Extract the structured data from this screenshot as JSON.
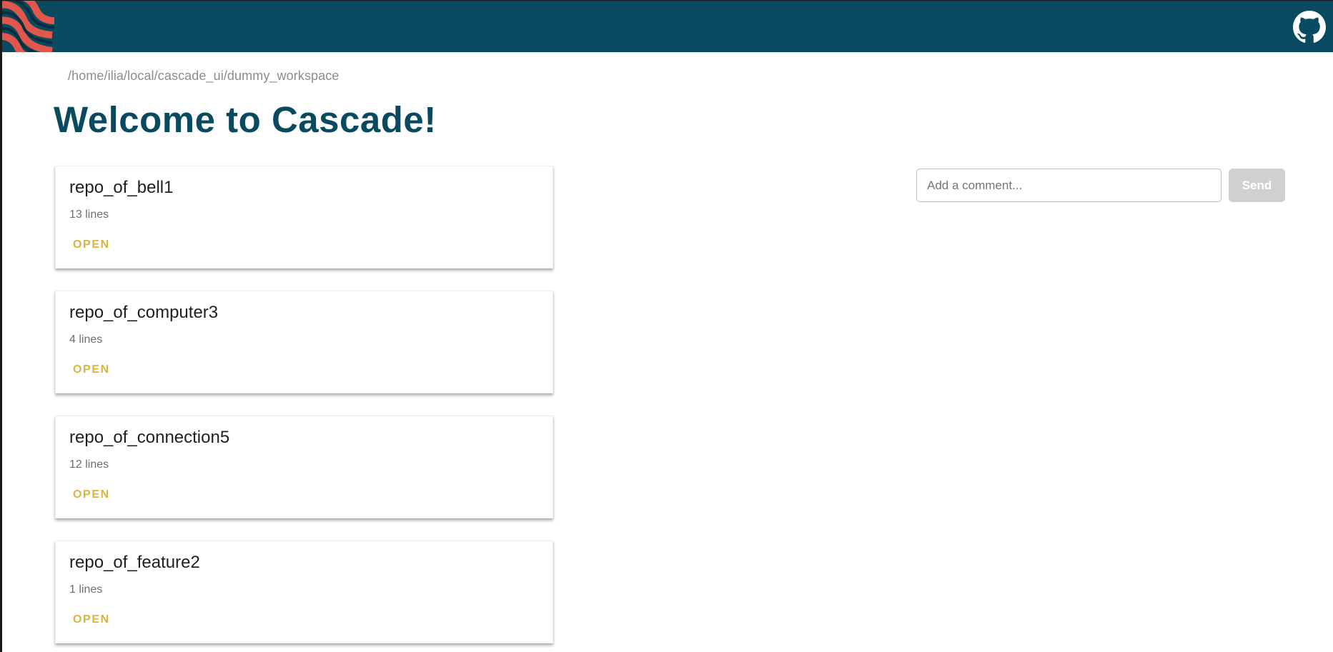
{
  "header": {
    "logo_icon": "cascade-logo-icon",
    "github_icon": "github-icon",
    "bar_color": "#0a4a61",
    "logo_color": "#e2574c"
  },
  "breadcrumb": {
    "path": "/home/ilia/local/cascade_ui/dummy_workspace"
  },
  "page": {
    "title": "Welcome to Cascade!"
  },
  "repos": [
    {
      "name": "repo_of_bell1",
      "lines": "13 lines",
      "action": "OPEN"
    },
    {
      "name": "repo_of_computer3",
      "lines": "4 lines",
      "action": "OPEN"
    },
    {
      "name": "repo_of_connection5",
      "lines": "12 lines",
      "action": "OPEN"
    },
    {
      "name": "repo_of_feature2",
      "lines": "1 lines",
      "action": "OPEN"
    }
  ],
  "comment": {
    "placeholder": "Add a comment...",
    "value": "",
    "send_label": "Send"
  },
  "colors": {
    "accent": "#e0b23a",
    "title": "#0a4a61",
    "send_disabled": "#d0d0d0"
  }
}
